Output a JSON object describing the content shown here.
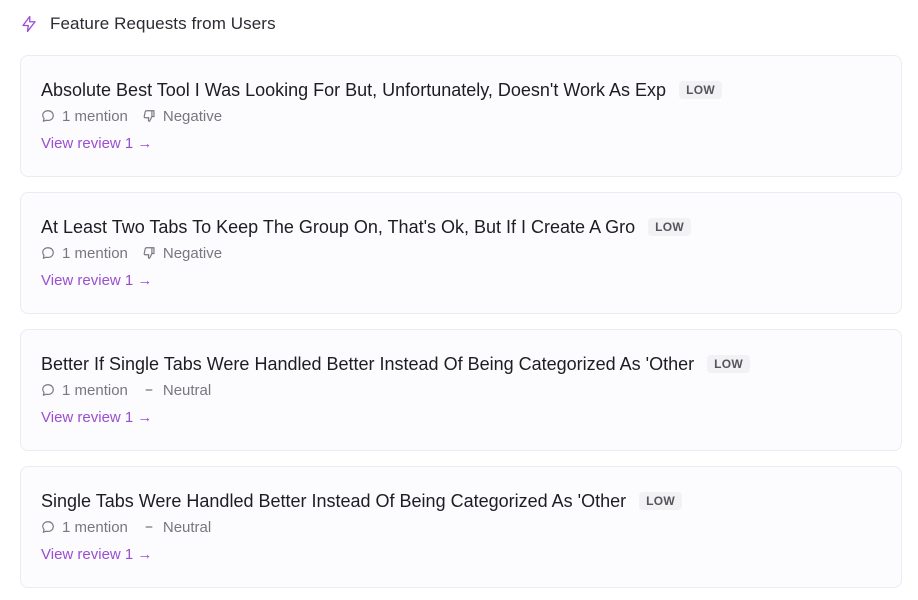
{
  "header": {
    "title": "Feature Requests from Users",
    "icon": "lightning-bolt-icon",
    "accent_color": "#9a4fd0"
  },
  "cards": [
    {
      "title": "Absolute Best Tool I Was Looking For But, Unfortunately, Doesn't Work As Exp",
      "badge": "LOW",
      "mentions": "1 mention",
      "sentiment": "Negative",
      "sentiment_icon": "thumbs-down-icon",
      "link": "View review 1 →"
    },
    {
      "title": "At Least Two Tabs To Keep The Group On, That's Ok, But If I Create A Gro",
      "badge": "LOW",
      "mentions": "1 mention",
      "sentiment": "Negative",
      "sentiment_icon": "thumbs-down-icon",
      "link": "View review 1 →"
    },
    {
      "title": "Better If Single Tabs Were Handled Better Instead Of Being Categorized As 'Other",
      "badge": "LOW",
      "mentions": "1 mention",
      "sentiment": "Neutral",
      "sentiment_icon": "dash-icon",
      "link": "View review 1 →"
    },
    {
      "title": "Single Tabs Were Handled Better Instead Of Being Categorized As 'Other",
      "badge": "LOW",
      "mentions": "1 mention",
      "sentiment": "Neutral",
      "sentiment_icon": "dash-icon",
      "link": "View review 1 →"
    }
  ]
}
